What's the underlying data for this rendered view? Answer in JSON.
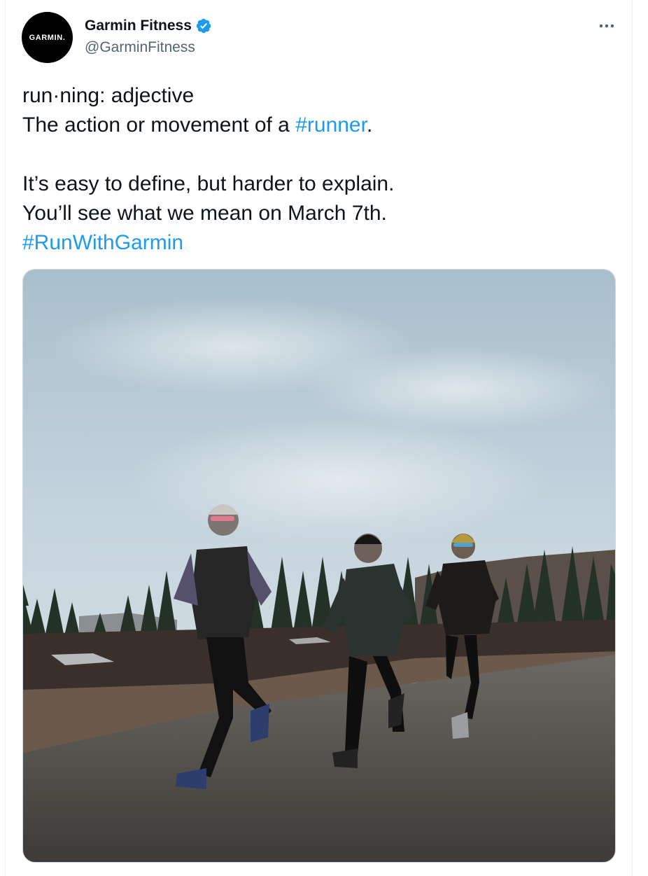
{
  "author": {
    "avatar_text": "GARMIN.",
    "name": "Garmin Fitness",
    "handle": "@GarminFitness",
    "verified_icon": "verified-badge-icon"
  },
  "more_icon": "more-options-icon",
  "tweet": {
    "line1": "run·ning: adjective",
    "line2_prefix": "The action or movement of a ",
    "line2_hashtag": "#runner",
    "line2_suffix": ".",
    "line3": "It’s easy to define, but harder to explain.",
    "line4": "You’ll see what we mean on March 7th.",
    "line5_hashtag": "#RunWithGarmin"
  },
  "colors": {
    "link": "#1d9bf0",
    "text": "#0f1419",
    "secondary": "#536471",
    "verified": "#1d9bf0"
  }
}
